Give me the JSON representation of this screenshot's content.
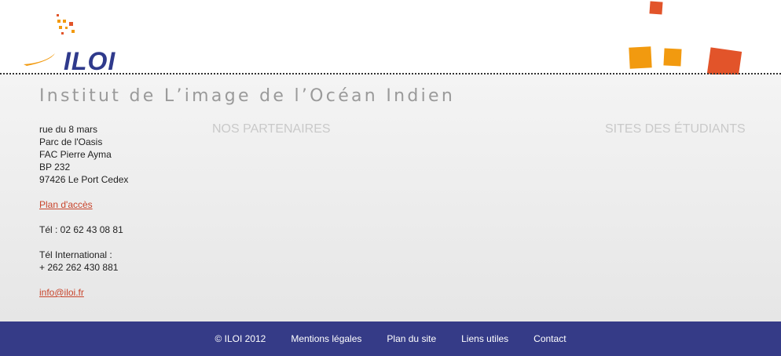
{
  "header": {
    "logo_text": "ILOI"
  },
  "tagline": "Institut de L’image de l’Océan Indien",
  "address": {
    "lines": [
      "rue du 8 mars",
      "Parc de l'Oasis",
      "FAC Pierre Ayma",
      "BP 232",
      "97426 Le Port Cedex"
    ],
    "map_link": "Plan d'accès",
    "phone": "Tél : 02 62 43 08 81",
    "intl_label": "Tél International :",
    "intl_number": "+ 262 262 430 881",
    "email": "info@iloi.fr"
  },
  "columns": {
    "partners_title": "NOS PARTENAIRES",
    "students_title": "SITES DES ÉTUDIANTS"
  },
  "footer": {
    "copyright": "© ILOI 2012",
    "links": [
      "Mentions légales",
      "Plan du site",
      "Liens utiles",
      "Contact"
    ]
  },
  "colors": {
    "footer_bg": "#353b87",
    "link": "#c8452c",
    "logo_blue": "#2f3a8c",
    "deco_orange": "#f29a0f",
    "deco_red": "#e2542a"
  }
}
